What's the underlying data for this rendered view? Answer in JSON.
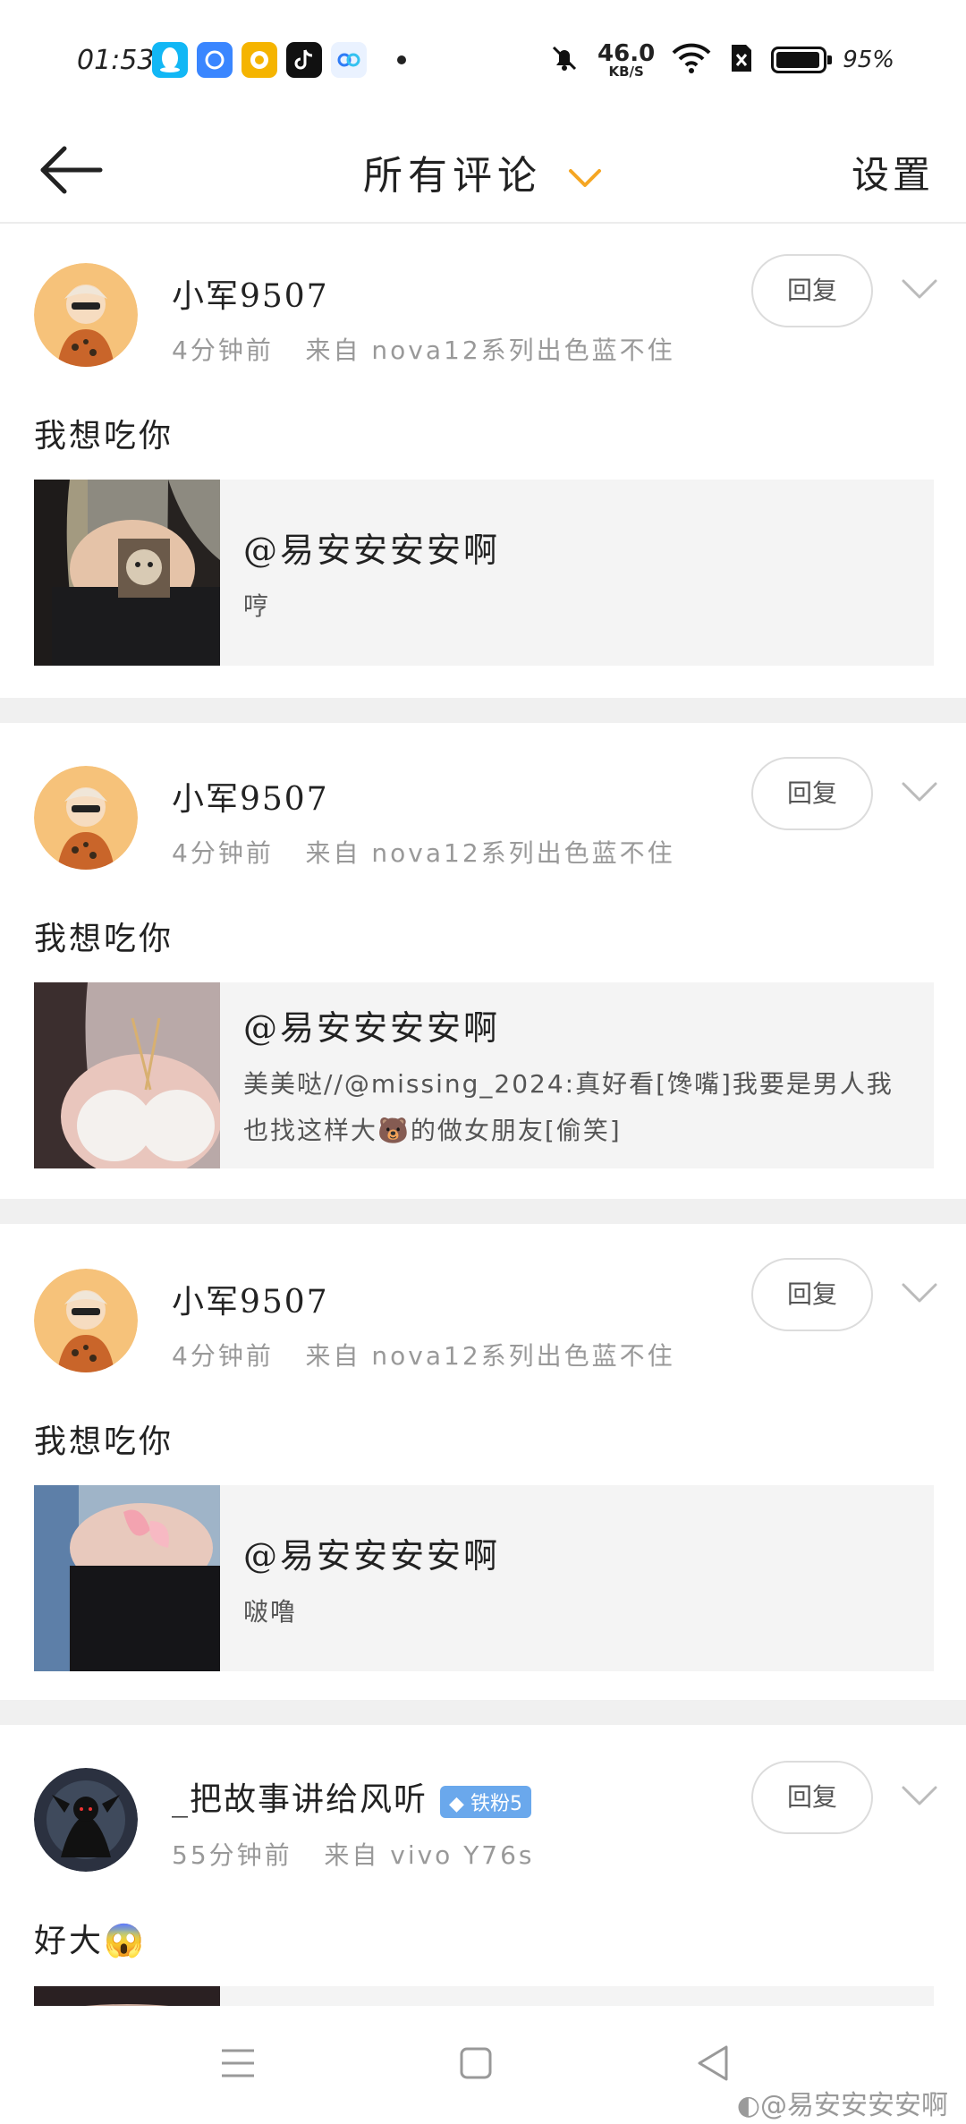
{
  "status_bar": {
    "time": "01:53",
    "net_speed": "46.0",
    "net_unit": "KB/S",
    "battery": "95%",
    "battery_level": 0.95,
    "app_icons": [
      "qq-icon",
      "browser-icon",
      "coin-app-icon",
      "tiktok-icon",
      "baidu-netdisk-icon"
    ]
  },
  "header": {
    "title": "所有评论",
    "settings": "设置"
  },
  "comments": [
    {
      "username": "小军9507",
      "time": "4分钟前",
      "source": "来自 nova12系列出色蓝不住",
      "reply": "回复",
      "text": "我想吃你",
      "quote_author": "@易安安安安啊",
      "quote_text": "哼"
    },
    {
      "username": "小军9507",
      "time": "4分钟前",
      "source": "来自 nova12系列出色蓝不住",
      "reply": "回复",
      "text": "我想吃你",
      "quote_author": "@易安安安安啊",
      "quote_text": "美美哒//@missing_2024:真好看[馋嘴]我要是男人我也找这样大🐻的做女朋友[偷笑]"
    },
    {
      "username": "小军9507",
      "time": "4分钟前",
      "source": "来自 nova12系列出色蓝不住",
      "reply": "回复",
      "text": "我想吃你",
      "quote_author": "@易安安安安啊",
      "quote_text": "啵噜"
    },
    {
      "username": "_把故事讲给风听",
      "badge": "铁粉5",
      "time": "55分钟前",
      "source": "来自 vivo Y76s",
      "reply": "回复",
      "text": "好大😱"
    }
  ],
  "watermark": "@易安安安安啊",
  "colors": {
    "accent": "#f5a623",
    "badge": "#6aa8ec",
    "divider": "#f0f0f0"
  }
}
